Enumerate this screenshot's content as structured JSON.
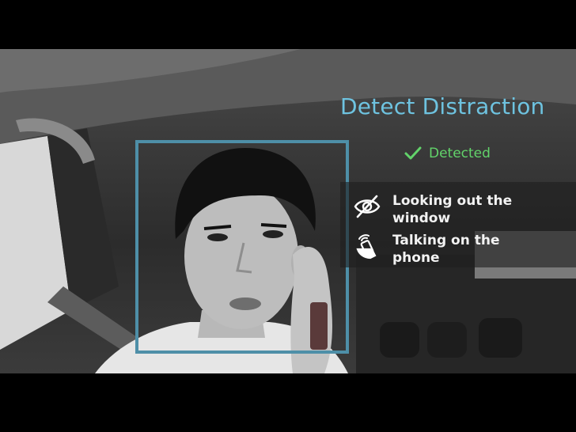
{
  "overlay": {
    "title": "Detect Distraction",
    "status": {
      "label": "Detected",
      "icon": "check-icon",
      "color": "#62d36a"
    },
    "distractions": [
      {
        "label": "Looking out the window",
        "icon": "eye-slash-icon"
      },
      {
        "label": "Talking on the phone",
        "icon": "hand-phone-icon"
      }
    ]
  },
  "colors": {
    "accent": "#6ec3e0",
    "face_box": "#4e8fa8",
    "success": "#62d36a"
  }
}
